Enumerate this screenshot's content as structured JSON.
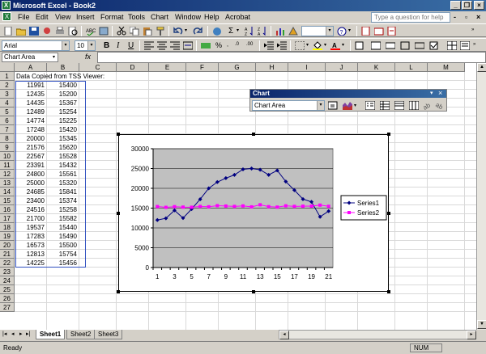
{
  "app": {
    "title": "Microsoft Excel - Book2"
  },
  "menu": [
    "File",
    "Edit",
    "View",
    "Insert",
    "Format",
    "Tools",
    "Chart",
    "Window",
    "Help",
    "Acrobat"
  ],
  "help_placeholder": "Type a question for help",
  "format_toolbar": {
    "font": "Arial",
    "size": "10"
  },
  "name_box": "Chart Area",
  "fx_label": "fx",
  "columns": [
    "A",
    "B",
    "C",
    "D",
    "E",
    "F",
    "G",
    "H",
    "I",
    "J",
    "K",
    "L",
    "M"
  ],
  "rows": [
    "1",
    "2",
    "3",
    "4",
    "5",
    "6",
    "7",
    "8",
    "9",
    "10",
    "11",
    "12",
    "13",
    "14",
    "15",
    "16",
    "17",
    "18",
    "19",
    "20",
    "21",
    "22",
    "23",
    "24",
    "25",
    "26",
    "27"
  ],
  "sheet": {
    "a1_text": "Data Copied from TSS Viewer:",
    "col_a": [
      "11991",
      "12435",
      "14435",
      "12489",
      "14774",
      "17248",
      "20000",
      "21576",
      "22567",
      "23391",
      "24800",
      "25000",
      "24685",
      "23400",
      "24516",
      "21700",
      "19537",
      "17283",
      "16573",
      "12813",
      "14225"
    ],
    "col_b": [
      "15400",
      "15200",
      "15367",
      "15254",
      "15225",
      "15420",
      "15345",
      "15620",
      "15528",
      "15432",
      "15561",
      "15320",
      "15841",
      "15374",
      "15258",
      "15582",
      "15440",
      "15490",
      "15500",
      "15754",
      "15456"
    ]
  },
  "chart_toolbar": {
    "title": "Chart",
    "selector": "Chart Area"
  },
  "tabs": [
    "Sheet1",
    "Sheet2",
    "Sheet3"
  ],
  "status": {
    "left": "Ready",
    "num": "NUM"
  },
  "chart_data": {
    "type": "line",
    "x": [
      1,
      2,
      3,
      4,
      5,
      6,
      7,
      8,
      9,
      10,
      11,
      12,
      13,
      14,
      15,
      16,
      17,
      18,
      19,
      20,
      21
    ],
    "x_ticks": [
      1,
      3,
      5,
      7,
      9,
      11,
      13,
      15,
      17,
      19,
      21
    ],
    "y_ticks": [
      0,
      5000,
      10000,
      15000,
      20000,
      25000,
      30000
    ],
    "ylim": [
      0,
      30000
    ],
    "series": [
      {
        "name": "Series1",
        "color": "#000080",
        "values": [
          11991,
          12435,
          14435,
          12489,
          14774,
          17248,
          20000,
          21576,
          22567,
          23391,
          24800,
          25000,
          24685,
          23400,
          24516,
          21700,
          19537,
          17283,
          16573,
          12813,
          14225
        ]
      },
      {
        "name": "Series2",
        "color": "#ff00ff",
        "values": [
          15400,
          15200,
          15367,
          15254,
          15225,
          15420,
          15345,
          15620,
          15528,
          15432,
          15561,
          15320,
          15841,
          15374,
          15258,
          15582,
          15440,
          15490,
          15500,
          15754,
          15456
        ]
      }
    ],
    "legend": "right",
    "plot_bg": "#c0c0c0",
    "grid": true
  }
}
